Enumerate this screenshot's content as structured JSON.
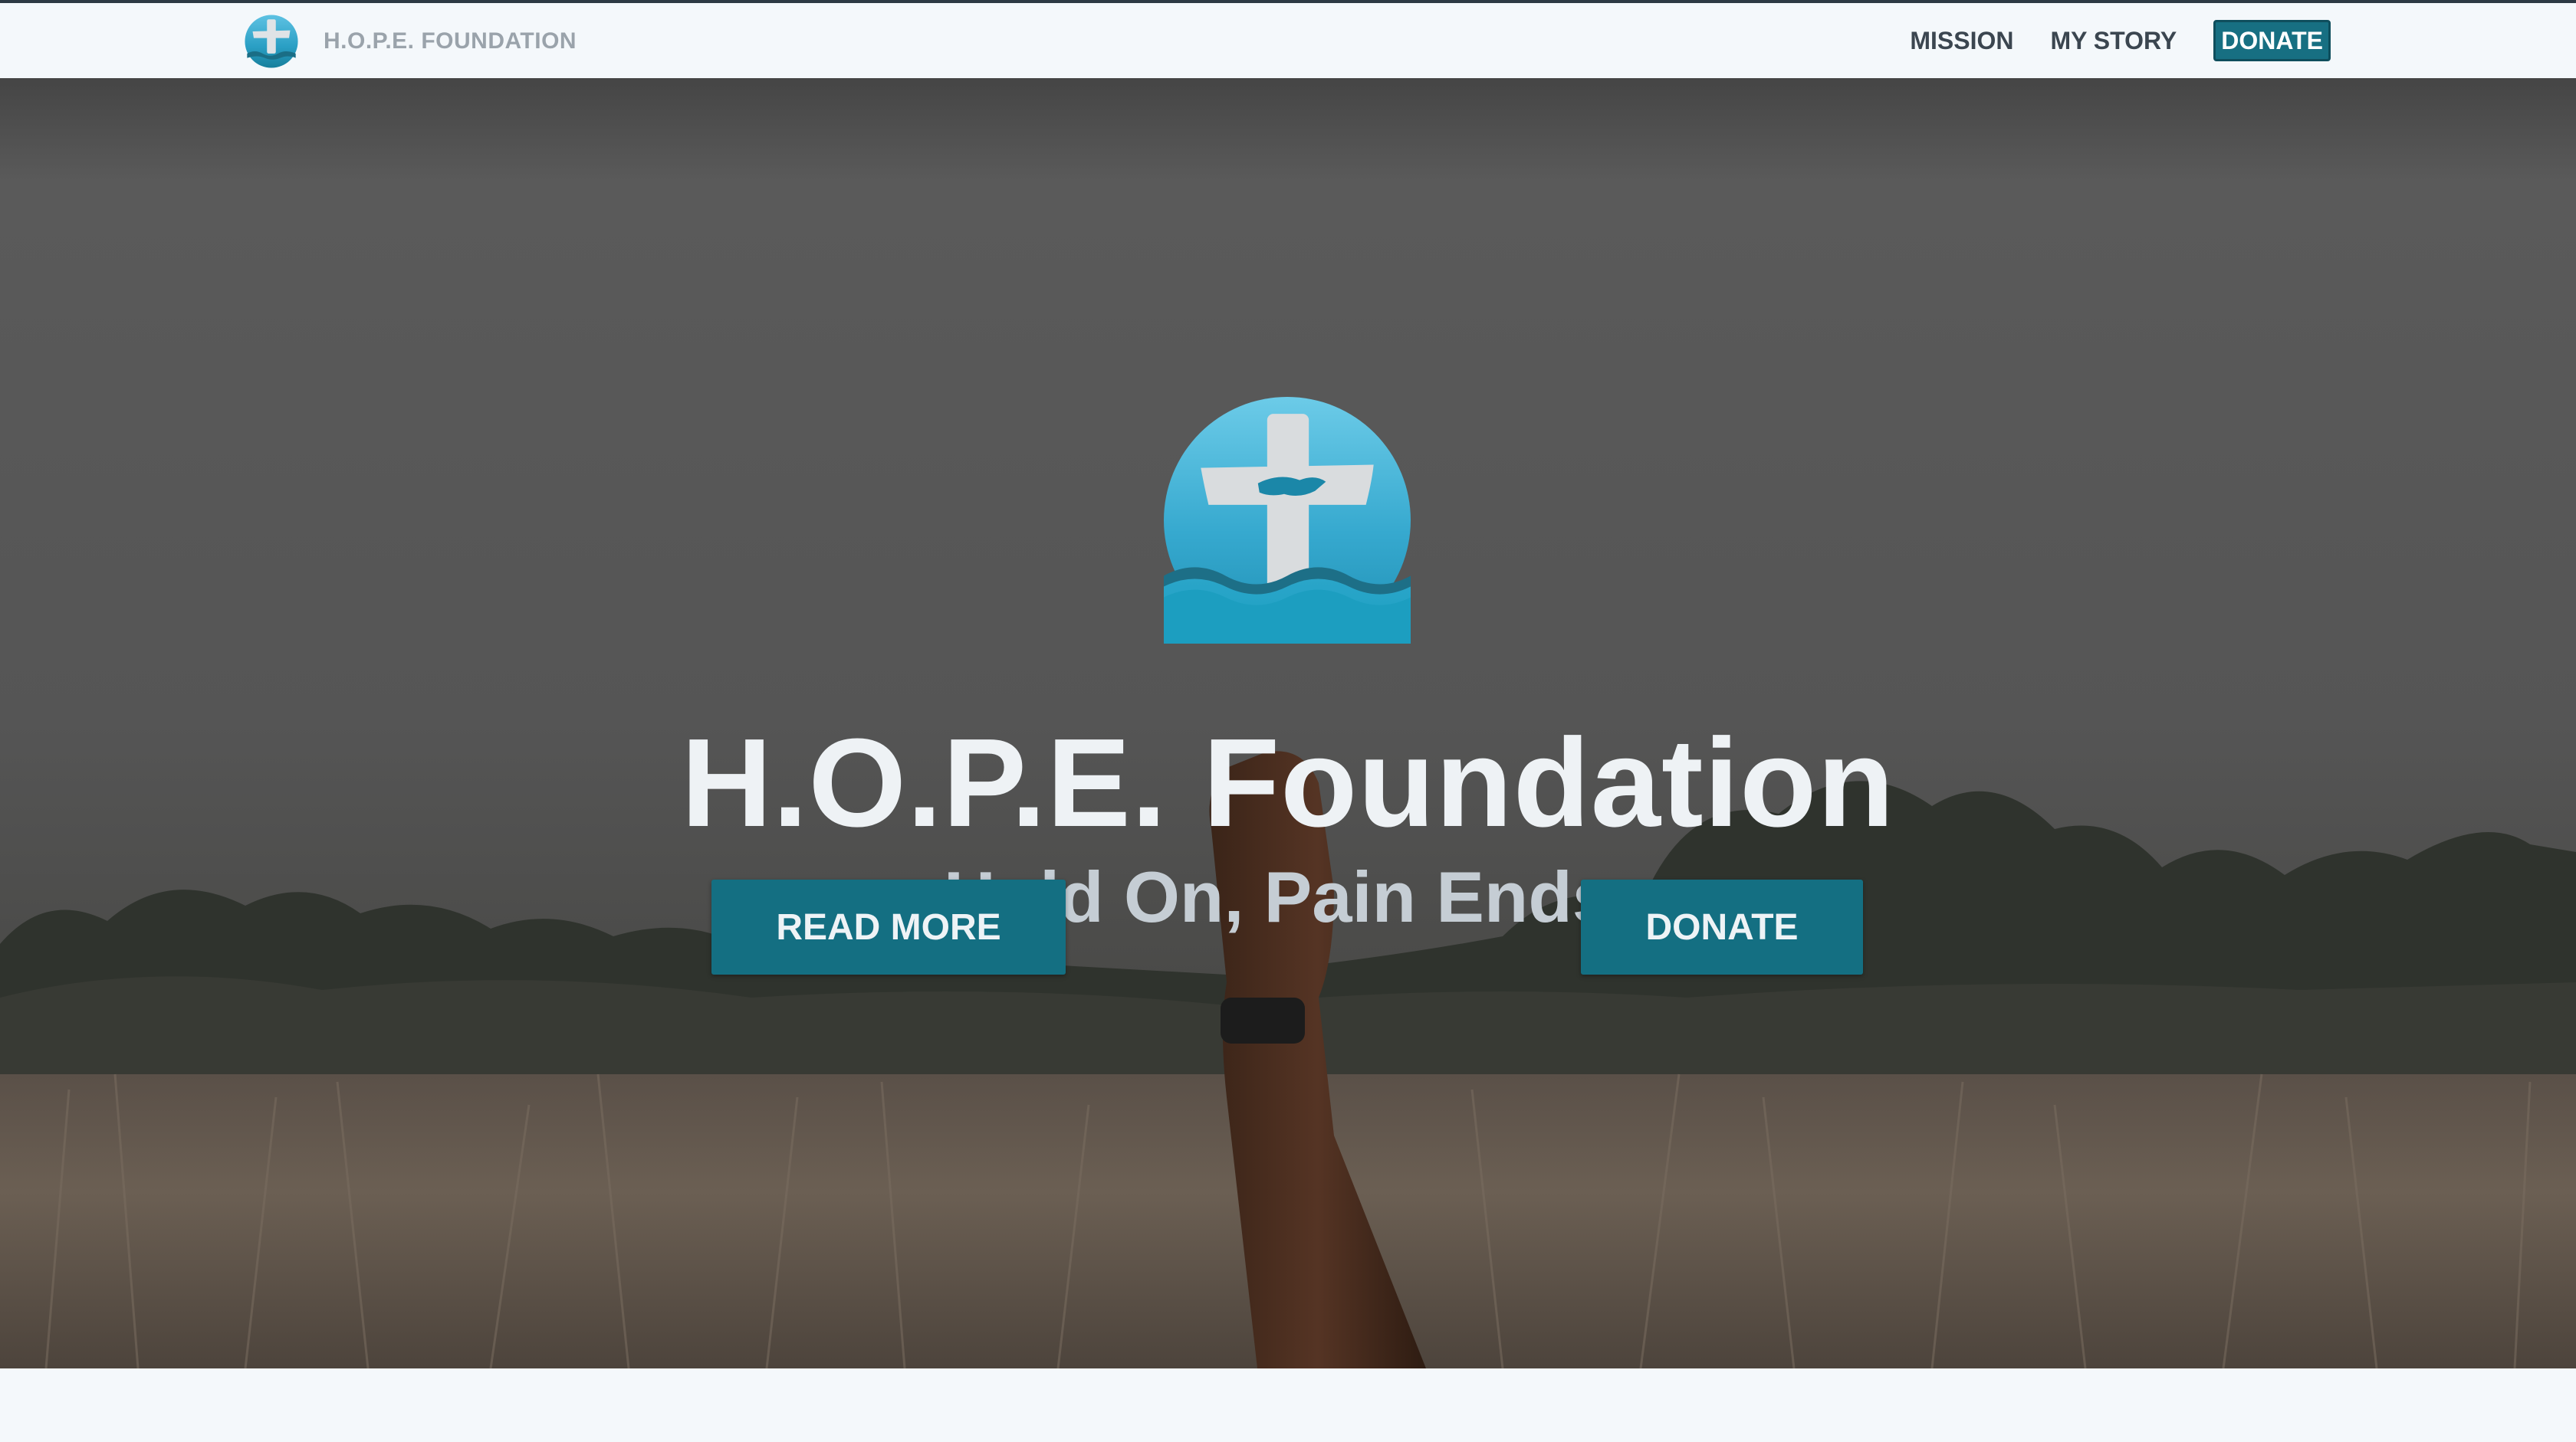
{
  "navbar": {
    "brand_name": "H.O.P.E. FOUNDATION",
    "brand_icon": "cross-logo-icon",
    "links": [
      {
        "label": "MISSION"
      },
      {
        "label": "MY STORY"
      }
    ],
    "donate_label": "DONATE"
  },
  "hero": {
    "logo_icon": "cross-handshake-logo-icon",
    "title": "H.O.P.E. Foundation",
    "subtitle": "Hold On, Pain Ends.",
    "read_more_label": "READ MORE",
    "donate_label": "DONATE"
  },
  "colors": {
    "accent": "#176f82",
    "logo_blue": "#3fb3d6",
    "nav_text": "#3b4650",
    "background": "#f4f8fb"
  }
}
